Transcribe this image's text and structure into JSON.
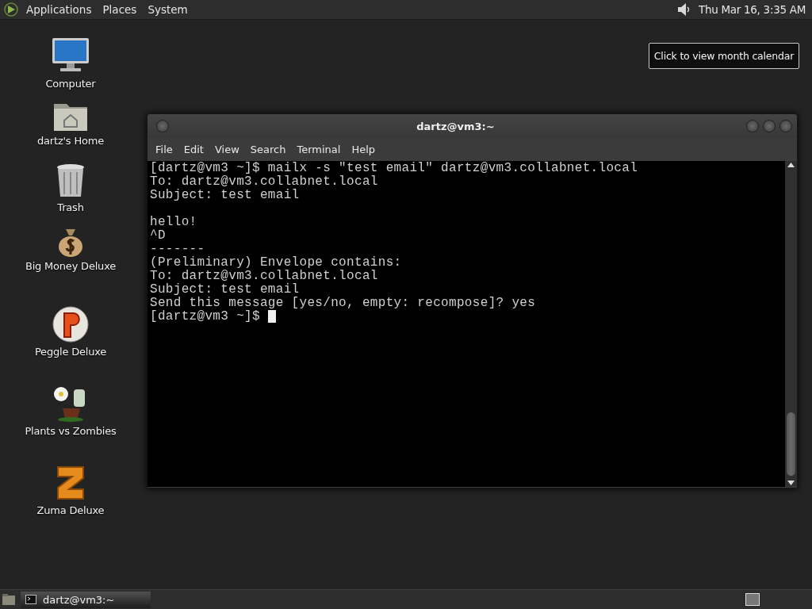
{
  "top_panel": {
    "menus": [
      "Applications",
      "Places",
      "System"
    ],
    "clock": "Thu Mar 16,  3:35 AM"
  },
  "tooltip": "Click to view month calendar",
  "desktop_icons": [
    {
      "label": "Computer",
      "kind": "computer"
    },
    {
      "label": "dartz's Home",
      "kind": "folder"
    },
    {
      "label": "Trash",
      "kind": "trash"
    },
    {
      "label": "Big Money Deluxe",
      "kind": "moneybag"
    },
    {
      "label": "Peggle Deluxe",
      "kind": "peggle"
    },
    {
      "label": "Plants vs Zombies",
      "kind": "plant"
    },
    {
      "label": "Zuma Deluxe",
      "kind": "zuma"
    }
  ],
  "terminal": {
    "title": "dartz@vm3:~",
    "menus": [
      "File",
      "Edit",
      "View",
      "Search",
      "Terminal",
      "Help"
    ],
    "lines": [
      {
        "kind": "text",
        "text": "[dartz@vm3 ~]$ mailx -s \"test email\" dartz@vm3.collabnet.local"
      },
      {
        "kind": "text",
        "text": "To: dartz@vm3.collabnet.local"
      },
      {
        "kind": "text",
        "text": "Subject: test email"
      },
      {
        "kind": "blank"
      },
      {
        "kind": "text",
        "text": "hello!"
      },
      {
        "kind": "text",
        "text": "^D"
      },
      {
        "kind": "text",
        "text": "-------"
      },
      {
        "kind": "text",
        "text": "(Preliminary) Envelope contains:"
      },
      {
        "kind": "text",
        "text": "To: dartz@vm3.collabnet.local"
      },
      {
        "kind": "text",
        "text": "Subject: test email"
      },
      {
        "kind": "text",
        "text": "Send this message [yes/no, empty: recompose]? yes"
      },
      {
        "kind": "text",
        "text": "[dartz@vm3 ~]$ "
      }
    ],
    "cursor": true
  },
  "taskbar": {
    "tasks": [
      {
        "label": "dartz@vm3:~",
        "selected": true
      }
    ]
  }
}
